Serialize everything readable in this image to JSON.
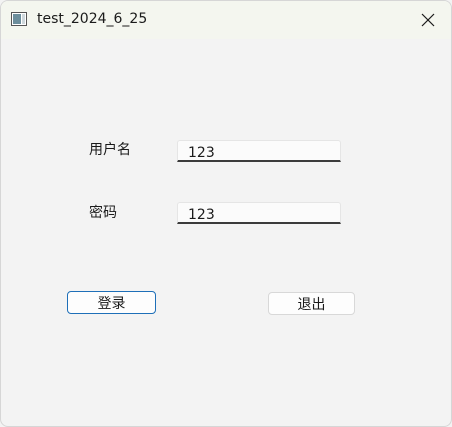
{
  "window": {
    "title": "test_2024_6_25",
    "close_icon": "close-icon",
    "app_icon": "window-app-icon"
  },
  "form": {
    "username": {
      "label": "用户名",
      "value": "123"
    },
    "password": {
      "label": "密码",
      "value": "123"
    }
  },
  "actions": {
    "login_label": "登录",
    "exit_label": "退出"
  },
  "colors": {
    "accent": "#1e6fb8",
    "background": "#f3f3f3",
    "titlebar": "#f4f6ef"
  }
}
